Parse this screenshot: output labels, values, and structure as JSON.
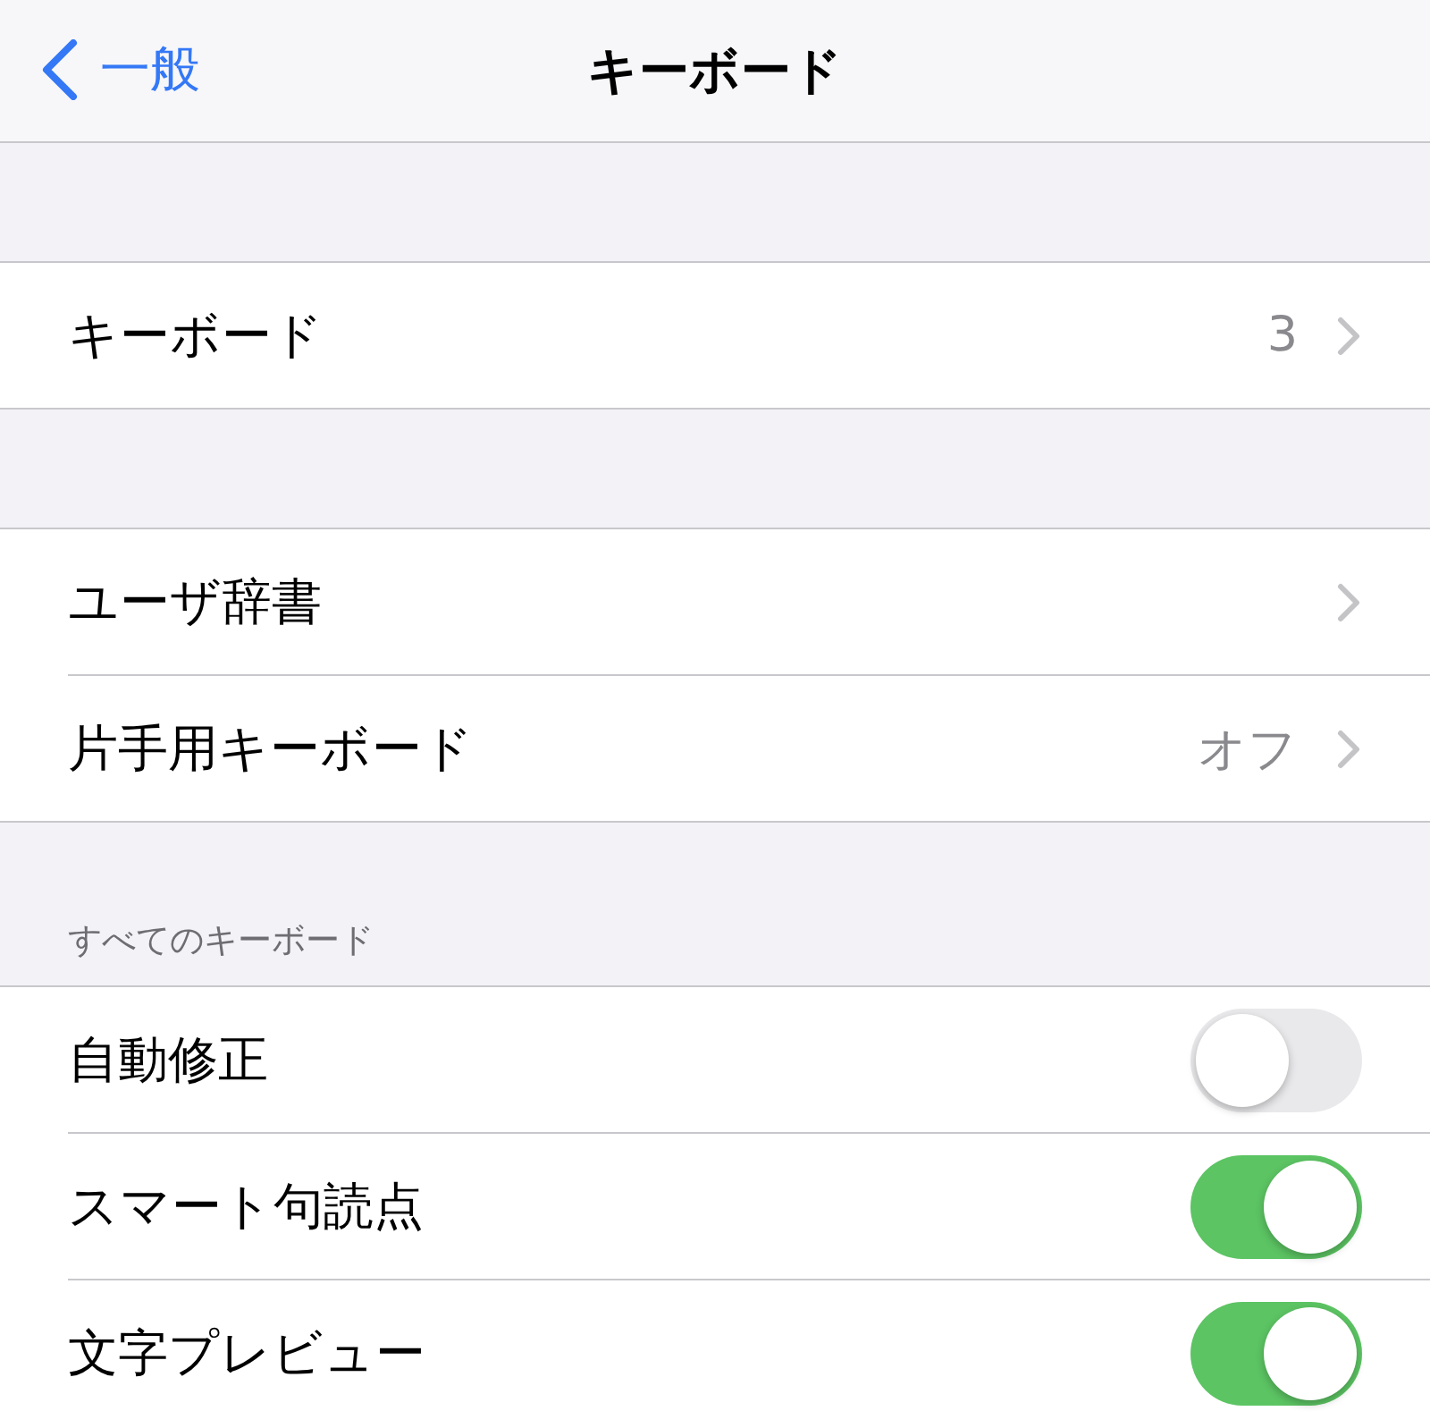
{
  "nav": {
    "back_label": "一般",
    "title": "キーボード"
  },
  "groups": [
    {
      "rows": [
        {
          "kind": "link",
          "label": "キーボード",
          "value": "3"
        }
      ]
    },
    {
      "rows": [
        {
          "kind": "link",
          "label": "ユーザ辞書"
        },
        {
          "kind": "link",
          "label": "片手用キーボード",
          "value": "オフ"
        }
      ]
    },
    {
      "header": "すべてのキーボード",
      "rows": [
        {
          "kind": "toggle",
          "label": "自動修正",
          "on": false
        },
        {
          "kind": "toggle",
          "label": "スマート句読点",
          "on": true
        },
        {
          "kind": "toggle",
          "label": "文字プレビュー",
          "on": true
        }
      ]
    }
  ]
}
